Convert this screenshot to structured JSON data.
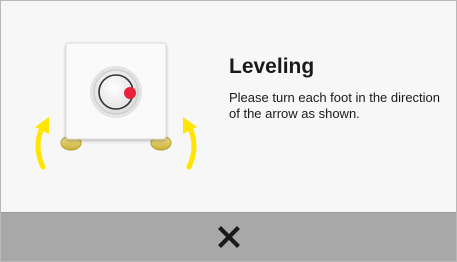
{
  "dialog": {
    "title": "Leveling",
    "message": "Please turn each foot in the direction of the arrow as shown."
  },
  "illustration": {
    "device_icon": "washer-top-view-icon",
    "knob_icon": "knob-icon",
    "indicator_color": "#e8203a",
    "foot_color": "#d9c65a",
    "arrow_color": "#ffe500",
    "left_arrow_icon": "rotate-left-arrow-icon",
    "right_arrow_icon": "rotate-right-arrow-icon"
  },
  "footer": {
    "close_icon": "close-icon",
    "background": "#a8a8a8"
  }
}
